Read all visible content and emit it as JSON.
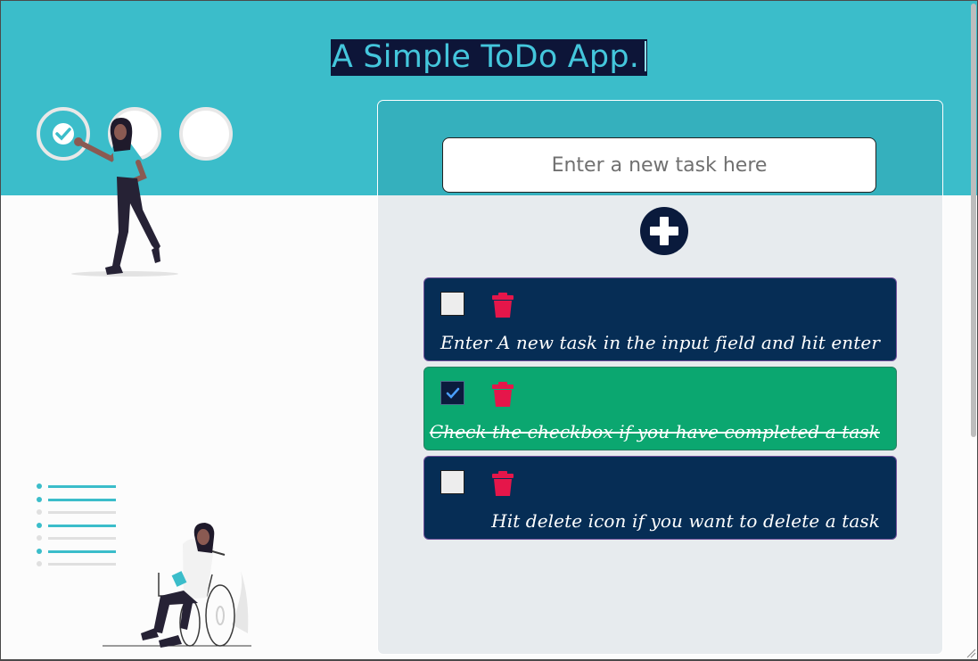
{
  "app": {
    "title": "A Simple ToDo App."
  },
  "input": {
    "placeholder": "Enter a new task here",
    "value": ""
  },
  "add_button": {
    "icon": "plus-circle-icon"
  },
  "tasks": [
    {
      "text": "Enter A new task in the input field and hit enter",
      "completed": false
    },
    {
      "text": "Check the checkbox if you have completed a task",
      "completed": true
    },
    {
      "text": "Hit delete icon if you want to delete a task",
      "completed": false
    }
  ],
  "colors": {
    "hero": "#3bbdca",
    "title_bg": "#0d1538",
    "title_text": "#44c6dc",
    "task_bg": "#062d55",
    "task_done_bg": "#0ba770",
    "delete_icon": "#e5164a",
    "add_button": "#0a1a3c"
  },
  "icons": {
    "delete": "trash-icon",
    "checkbox": "checkbox-icon"
  }
}
